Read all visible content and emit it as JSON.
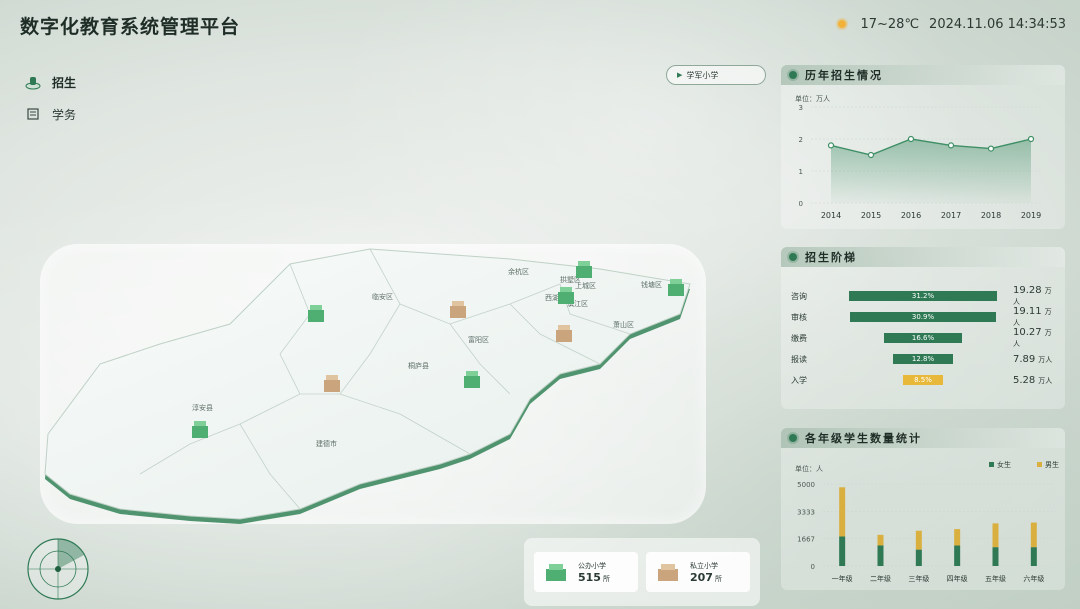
{
  "header": {
    "title": "数字化教育系统管理平台",
    "weather_icon": "sun-icon",
    "temperature": "17~28℃",
    "datetime": "2024.11.06 14:34:53"
  },
  "nav": {
    "items": [
      {
        "label": "招生",
        "icon": "enroll-icon",
        "active": true
      },
      {
        "label": "学务",
        "icon": "affairs-icon",
        "active": false
      }
    ]
  },
  "school_select": {
    "value": "学军小学"
  },
  "map": {
    "districts": [
      "余杭区",
      "拱墅区",
      "上城区",
      "西湖区",
      "滨江区",
      "临安区",
      "富阳区",
      "萧山区",
      "钱塘区",
      "桐庐县",
      "淳安县",
      "建德市"
    ]
  },
  "school_stats": [
    {
      "name": "公办小学",
      "value": "515",
      "unit": "所",
      "icon": "school-building-icon"
    },
    {
      "name": "私立小学",
      "value": "207",
      "unit": "所",
      "icon": "school-building-icon"
    }
  ],
  "panels": {
    "history_title": "历年招生情况",
    "funnel_title": "招生阶梯",
    "grade_title": "各年级学生数量统计"
  },
  "chart_data": [
    {
      "type": "area",
      "title": "历年招生情况",
      "unit_label": "单位：万人",
      "x": [
        "2014",
        "2015",
        "2016",
        "2017",
        "2018",
        "2019"
      ],
      "y": [
        1.8,
        1.5,
        2.0,
        1.8,
        1.7,
        2.0
      ],
      "ylim": [
        0,
        3
      ],
      "yticks": [
        "0",
        "1",
        "2",
        "3"
      ],
      "color": "#3f8f66"
    },
    {
      "type": "bar",
      "title": "招生阶梯",
      "categories": [
        "咨询",
        "审核",
        "缴费",
        "报读",
        "入学"
      ],
      "percent_labels": [
        "31.2%",
        "30.9%",
        "16.6%",
        "12.8%",
        "8.5%"
      ],
      "percent_values": [
        31.2,
        30.9,
        16.6,
        12.8,
        8.5
      ],
      "values": [
        "19.28",
        "19.11",
        "10.27",
        "7.89",
        "5.28"
      ],
      "unit": "万人",
      "colors": [
        "#2f7a55",
        "#2f7a55",
        "#2f7a55",
        "#2f7a55",
        "#e8b83a"
      ]
    },
    {
      "type": "bar",
      "title": "各年级学生数量统计",
      "unit_label": "单位：人",
      "categories": [
        "一年级",
        "二年级",
        "三年级",
        "四年级",
        "五年级",
        "六年级"
      ],
      "series": [
        {
          "name": "女生",
          "color": "#2f7a55",
          "values": [
            1800,
            1250,
            1000,
            1250,
            1150,
            1150
          ]
        },
        {
          "name": "男生",
          "color": "#d9b040",
          "values": [
            3000,
            650,
            1150,
            1000,
            1450,
            1500
          ]
        }
      ],
      "ylim": [
        0,
        5000
      ],
      "yticks": [
        "0",
        "1667",
        "3333",
        "5000"
      ],
      "legend": "top-right"
    }
  ]
}
